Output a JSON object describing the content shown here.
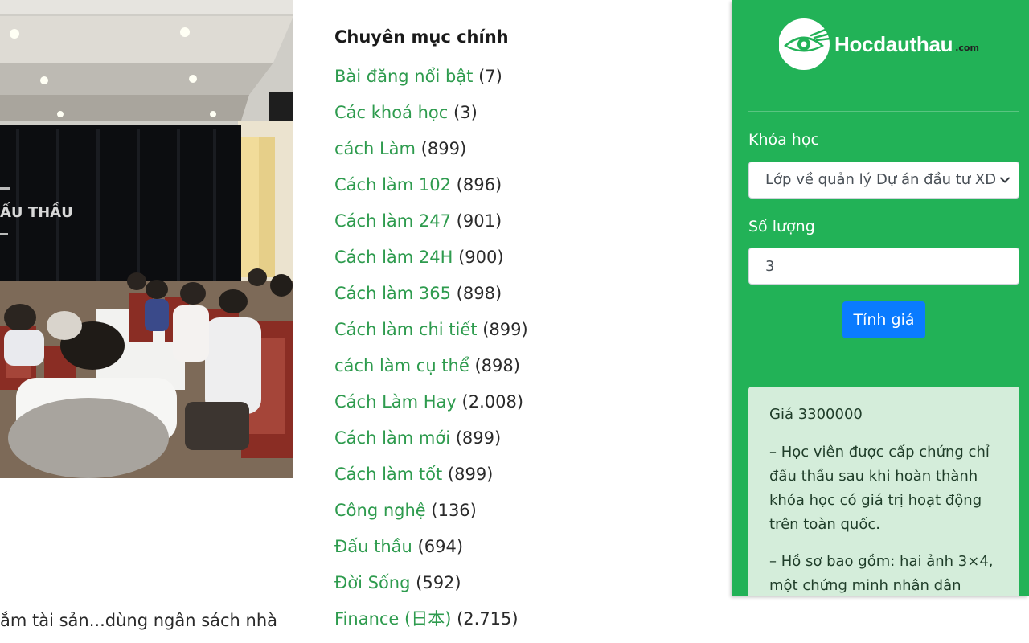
{
  "photo": {
    "icon": "conference-photo",
    "banner_text": "ẤU THẦU"
  },
  "excerpt": {
    "text": "ắm tài sản...dùng ngân sách nhà"
  },
  "categories": {
    "heading": "Chuyên mục chính",
    "items": [
      {
        "label": "Bài đăng nổi bật",
        "count": "(7)"
      },
      {
        "label": "Các khoá học",
        "count": "(3)"
      },
      {
        "label": "cách Làm",
        "count": "(899)"
      },
      {
        "label": "Cách làm 102",
        "count": "(896)"
      },
      {
        "label": "Cách làm 247",
        "count": "(901)"
      },
      {
        "label": "Cách làm 24H",
        "count": "(900)"
      },
      {
        "label": "Cách làm 365",
        "count": "(898)"
      },
      {
        "label": "Cách làm chi tiết",
        "count": "(899)"
      },
      {
        "label": "cách làm cụ thể",
        "count": "(898)"
      },
      {
        "label": "Cách Làm Hay",
        "count": "(2.008)"
      },
      {
        "label": "Cách làm mới",
        "count": "(899)"
      },
      {
        "label": "Cách làm tốt",
        "count": "(899)"
      },
      {
        "label": "Công nghệ",
        "count": "(136)"
      },
      {
        "label": "Đấu thầu",
        "count": "(694)"
      },
      {
        "label": "Đời Sống",
        "count": "(592)"
      },
      {
        "label": "Finance (日本)",
        "count": "(2.715)"
      }
    ]
  },
  "widget": {
    "logo_text": "Hocdauthau",
    "logo_suffix": ".com",
    "logo_icon": "eye-logo-icon",
    "course_label": "Khóa học",
    "course_selected": "Lớp về quản lý Dự án đầu tư XD",
    "quantity_label": "Số lượng",
    "quantity_value": "3",
    "calc_button": "Tính giá",
    "result": {
      "price_line": "Giá 3300000",
      "paragraph1": "– Học viên được cấp chứng chỉ đấu thầu sau khi hoàn thành khóa học có giá trị hoạt động trên toàn quốc.",
      "paragraph2": "– Hồ sơ bao gồm: hai ảnh 3×4, một chứng minh nhân dân"
    },
    "colors": {
      "background": "#22b257",
      "button": "#0a7bff",
      "result_bg": "#d4edda",
      "link": "#2e9b4e"
    }
  }
}
